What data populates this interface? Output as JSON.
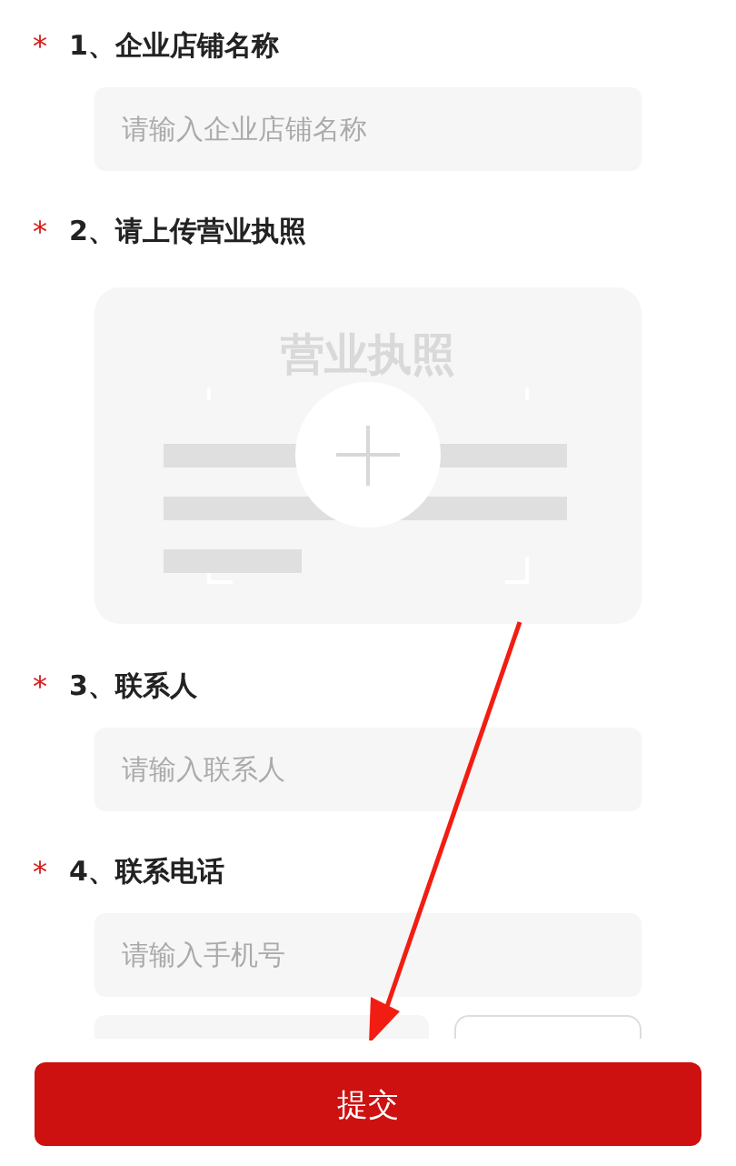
{
  "required_mark": "*",
  "fields": [
    {
      "kind": "text",
      "label": "1、企业店铺名称",
      "required": true,
      "placeholder": "请输入企业店铺名称"
    },
    {
      "kind": "upload",
      "label": "2、请上传营业执照",
      "required": true,
      "card_title": "营业执照"
    },
    {
      "kind": "text",
      "label": "3、联系人",
      "required": true,
      "placeholder": "请输入联系人"
    },
    {
      "kind": "text",
      "label": "4、联系电话",
      "required": true,
      "placeholder": "请输入手机号",
      "code_row": true
    }
  ],
  "submit": "提交"
}
